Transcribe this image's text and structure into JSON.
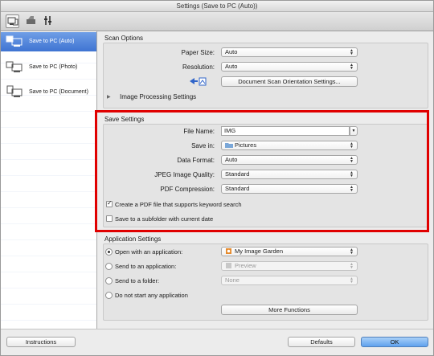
{
  "window": {
    "title": "Settings (Save to PC (Auto))"
  },
  "toolbar": {
    "buttons": [
      {
        "icon": "scan-from-computer-icon"
      },
      {
        "icon": "scan-from-panel-icon"
      },
      {
        "icon": "general-settings-icon"
      }
    ]
  },
  "sidebar": {
    "items": [
      {
        "label": "Save to PC (Auto)",
        "icon": "auto-scan-icon",
        "active": true
      },
      {
        "label": "Save to PC (Photo)",
        "icon": "photo-scan-icon",
        "active": false
      },
      {
        "label": "Save to PC (Document)",
        "icon": "document-scan-icon",
        "active": false
      }
    ]
  },
  "scan_options": {
    "title": "Scan Options",
    "paper_size": {
      "label": "Paper Size:",
      "value": "Auto"
    },
    "resolution": {
      "label": "Resolution:",
      "value": "Auto"
    },
    "orientation_button": "Document Scan Orientation Settings...",
    "image_processing": "Image Processing Settings"
  },
  "save_settings": {
    "title": "Save Settings",
    "file_name": {
      "label": "File Name:",
      "value": "IMG"
    },
    "save_in": {
      "label": "Save in:",
      "value": "Pictures"
    },
    "data_format": {
      "label": "Data Format:",
      "value": "Auto"
    },
    "jpeg_quality": {
      "label": "JPEG Image Quality:",
      "value": "Standard"
    },
    "pdf_compression": {
      "label": "PDF Compression:",
      "value": "Standard"
    },
    "pdf_keyword": {
      "label": "Create a PDF file that supports keyword search",
      "checked": true
    },
    "subfolder": {
      "label": "Save to a subfolder with current date",
      "checked": false
    }
  },
  "application_settings": {
    "title": "Application Settings",
    "open_app": {
      "label": "Open with an application:",
      "value": "My Image Garden",
      "selected": true
    },
    "send_app": {
      "label": "Send to an application:",
      "value": "Preview",
      "selected": false
    },
    "send_folder": {
      "label": "Send to a folder:",
      "value": "None",
      "selected": false
    },
    "no_app": {
      "label": "Do not start any application",
      "selected": false
    },
    "more_functions": "More Functions"
  },
  "footer": {
    "instructions": "Instructions",
    "defaults": "Defaults",
    "ok": "OK"
  },
  "colors": {
    "highlight_box": "#e00000",
    "selection": "#3f74d2"
  }
}
